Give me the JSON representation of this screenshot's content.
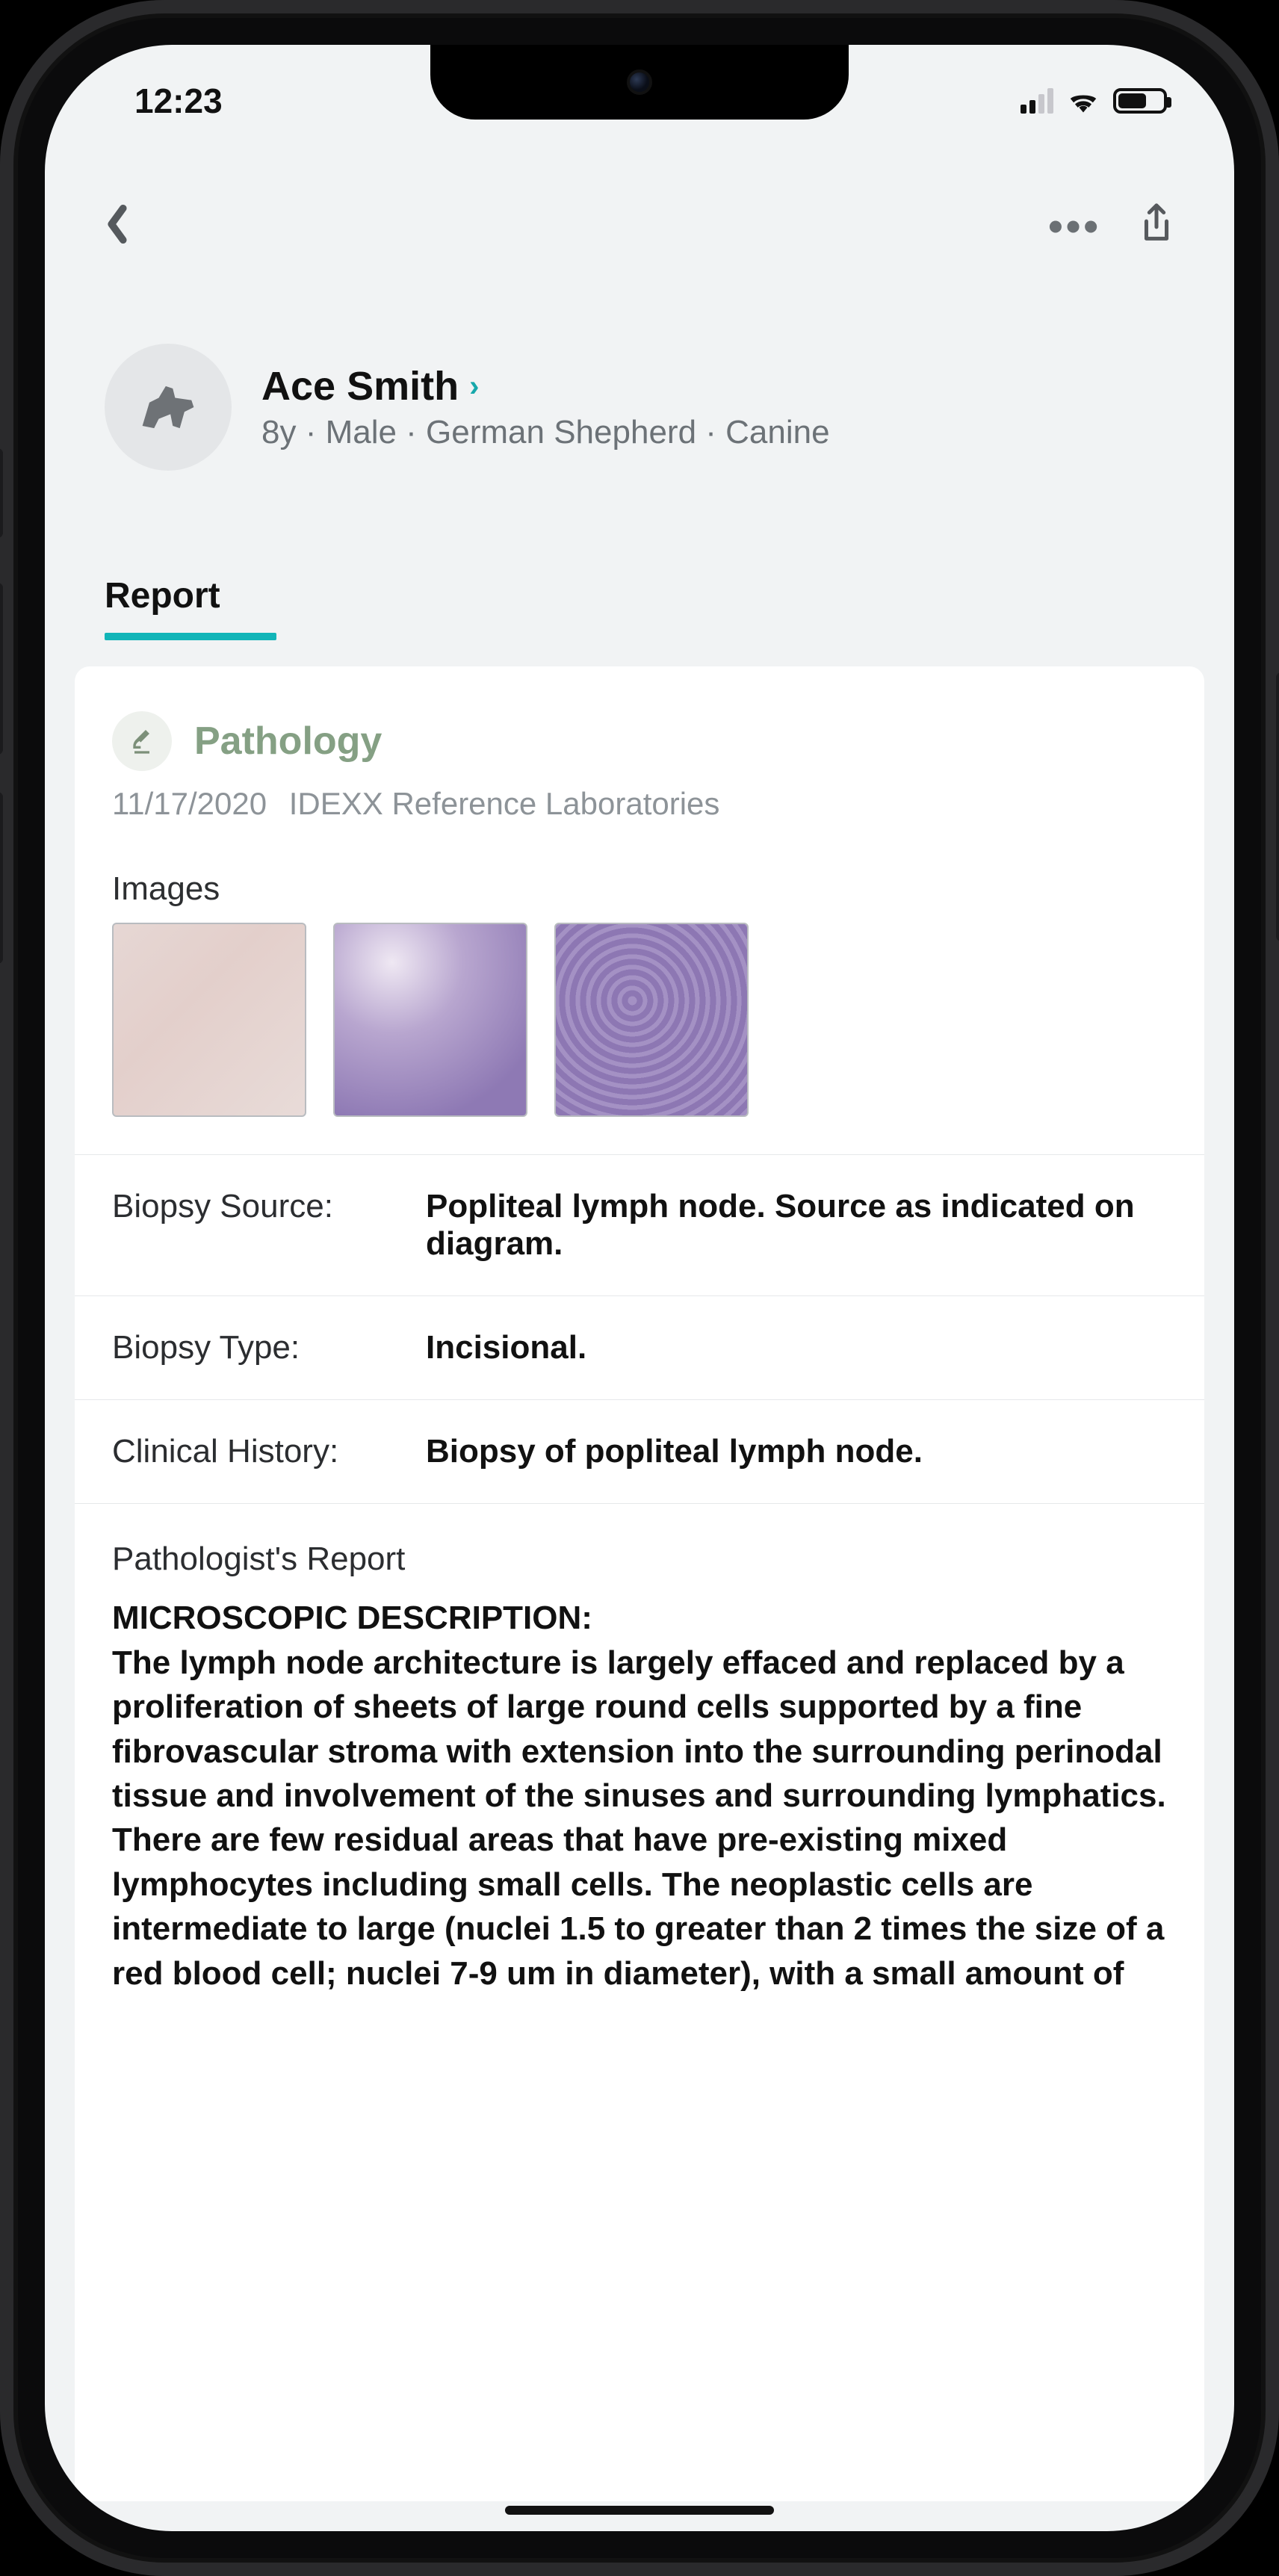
{
  "status_bar": {
    "time": "12:23"
  },
  "patient": {
    "name": "Ace Smith",
    "meta": "8y · Male · German Shepherd · Canine"
  },
  "tabs": {
    "report": "Report"
  },
  "report": {
    "section_title": "Pathology",
    "date": "11/17/2020",
    "lab": "IDEXX Reference Laboratories",
    "images_label": "Images",
    "rows": [
      {
        "label": "Biopsy Source:",
        "value": "Popliteal lymph node. Source as indicated on diagram."
      },
      {
        "label": "Biopsy Type:",
        "value": "Incisional."
      },
      {
        "label": "Clinical History:",
        "value": "Biopsy of popliteal lymph node."
      }
    ],
    "pathologist_label": "Pathologist's Report",
    "microscopic_heading": "MICROSCOPIC DESCRIPTION:",
    "microscopic_body": "The lymph node architecture is largely effaced and replaced by a proliferation of sheets of large round cells supported by a fine fibrovascular stroma with extension into the surrounding perinodal tissue and involvement of the sinuses and surrounding lymphatics. There are few residual areas that have pre-existing mixed lymphocytes including small cells. The neoplastic cells are intermediate to large (nuclei 1.5 to greater than 2 times the size of a red blood cell; nuclei 7-9 um in diameter), with a small amount of"
  }
}
